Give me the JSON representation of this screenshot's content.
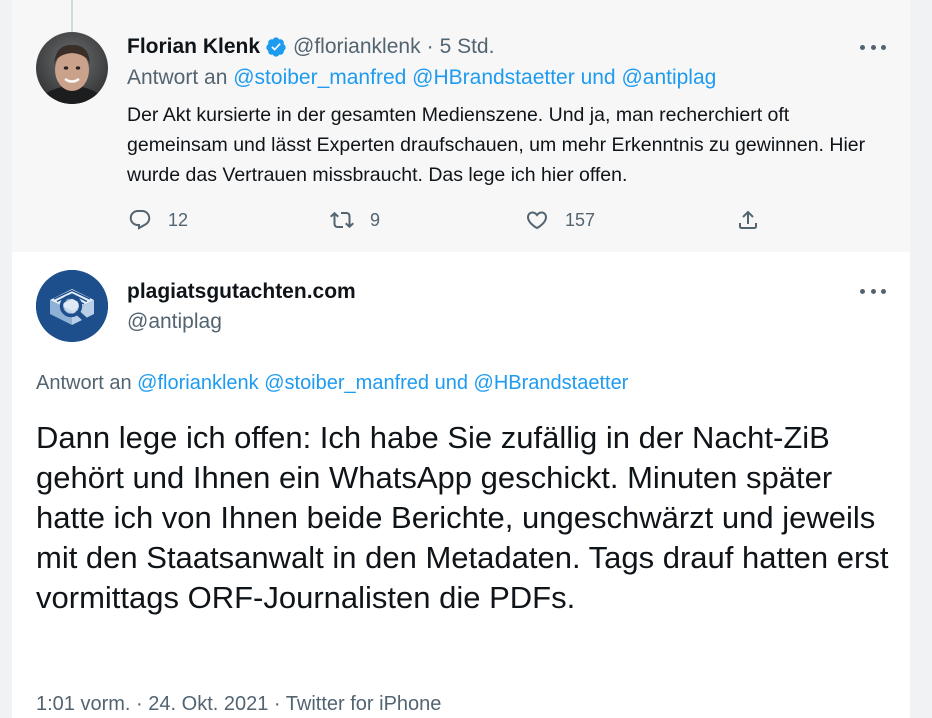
{
  "parent_tweet": {
    "author_name": "Florian Klenk",
    "handle": "@florianklenk",
    "separator": "·",
    "time": "5 Std.",
    "reply_prefix": "Antwort an",
    "reply_mentions": [
      "@stoiber_manfred",
      "@HBrandstaetter"
    ],
    "reply_and": "und",
    "reply_last_mention": "@antiplag",
    "text": "Der Akt kursierte in der gesamten Medienszene. Und ja, man recherchiert oft gemeinsam und lässt Experten draufschauen, um mehr Erkenntnis zu gewinnen. Hier wurde das Vertrauen missbraucht. Das lege ich hier offen.",
    "reply_count": "12",
    "retweet_count": "9",
    "like_count": "157",
    "icons": [
      "verified-badge-icon",
      "more-icon",
      "reply-icon",
      "retweet-icon",
      "like-icon",
      "share-icon"
    ]
  },
  "main_tweet": {
    "author_name": "plagiatsgutachten.com",
    "handle": "@antiplag",
    "reply_prefix": "Antwort an",
    "reply_mentions": [
      "@florianklenk",
      "@stoiber_manfred"
    ],
    "reply_and": "und",
    "reply_last_mention": "@HBrandstaetter",
    "text": "Dann lege ich offen: Ich habe Sie zufällig in der Nacht-ZiB gehört und Ihnen ein WhatsApp geschickt. Minuten später hatte ich von Ihnen beide Berichte, ungeschwärzt und jeweils mit den Staatsanwalt in den Metadaten. Tags drauf hatten erst vormittags ORF-Journalisten die PDFs.",
    "time": "1:01 vorm.",
    "separator": "·",
    "date": "24. Okt. 2021",
    "client": "Twitter for iPhone",
    "icons": [
      "more-icon"
    ]
  },
  "colors": {
    "accent_blue": "#1d9bf0",
    "text_primary": "#0f1419",
    "text_secondary": "#536471",
    "parent_background": "#f7f7f7",
    "like_heart": "#536471"
  }
}
